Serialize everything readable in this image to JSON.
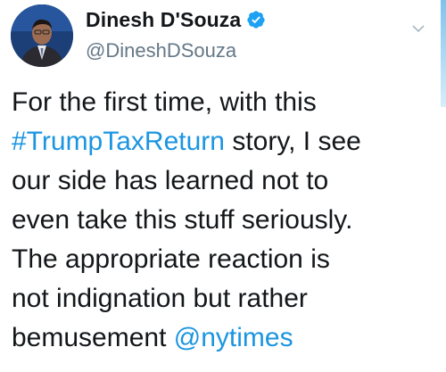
{
  "author": {
    "display_name": "Dinesh D'Souza",
    "handle": "@DineshDSouza",
    "verified": true
  },
  "tweet": {
    "lines": [
      {
        "parts": [
          {
            "text": "For the first time, with this",
            "type": "text"
          }
        ]
      },
      {
        "parts": [
          {
            "text": "#TrumpTaxReturn",
            "type": "hashtag"
          },
          {
            "text": " story, I see",
            "type": "text"
          }
        ]
      },
      {
        "parts": [
          {
            "text": "our side has learned not to",
            "type": "text"
          }
        ]
      },
      {
        "parts": [
          {
            "text": "even take this stuff seriously.",
            "type": "text"
          }
        ]
      },
      {
        "parts": [
          {
            "text": "The appropriate reaction is",
            "type": "text"
          }
        ]
      },
      {
        "parts": [
          {
            "text": "not indignation but rather",
            "type": "text"
          }
        ]
      },
      {
        "parts": [
          {
            "text": "bemusement ",
            "type": "text"
          },
          {
            "text": "@nytimes",
            "type": "mention"
          }
        ]
      }
    ]
  },
  "icons": {
    "verified": "verified-badge-icon",
    "menu": "chevron-down-icon"
  },
  "colors": {
    "text": "#14171a",
    "secondary": "#657786",
    "link": "#1b95e0",
    "verified": "#1da1f2"
  }
}
